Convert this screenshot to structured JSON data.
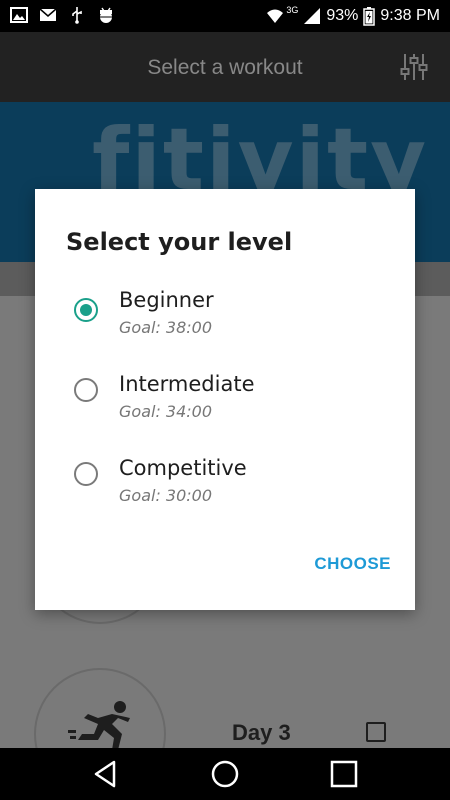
{
  "status_bar": {
    "battery": "93%",
    "time": "9:38 PM",
    "network": "3G",
    "icons": [
      "image-icon",
      "mail-icon",
      "usb-icon",
      "android-debug-icon",
      "wifi-icon",
      "signal-icon",
      "battery-icon"
    ]
  },
  "app_bar": {
    "title": "Select a workout",
    "action_icon": "filter-sliders-icon"
  },
  "background": {
    "banner_logo": "fitivity",
    "day_label": "Day 3"
  },
  "dialog": {
    "title": "Select your level",
    "options": [
      {
        "label": "Beginner",
        "goal": "Goal: 38:00",
        "selected": true
      },
      {
        "label": "Intermediate",
        "goal": "Goal: 34:00",
        "selected": false
      },
      {
        "label": "Competitive",
        "goal": "Goal: 30:00",
        "selected": false
      }
    ],
    "choose_label": "CHOOSE"
  },
  "colors": {
    "accent": "#1aa08a",
    "button_text": "#1e9ad6"
  },
  "nav_bar": {
    "icons": [
      "back-icon",
      "home-icon",
      "recents-icon"
    ]
  }
}
